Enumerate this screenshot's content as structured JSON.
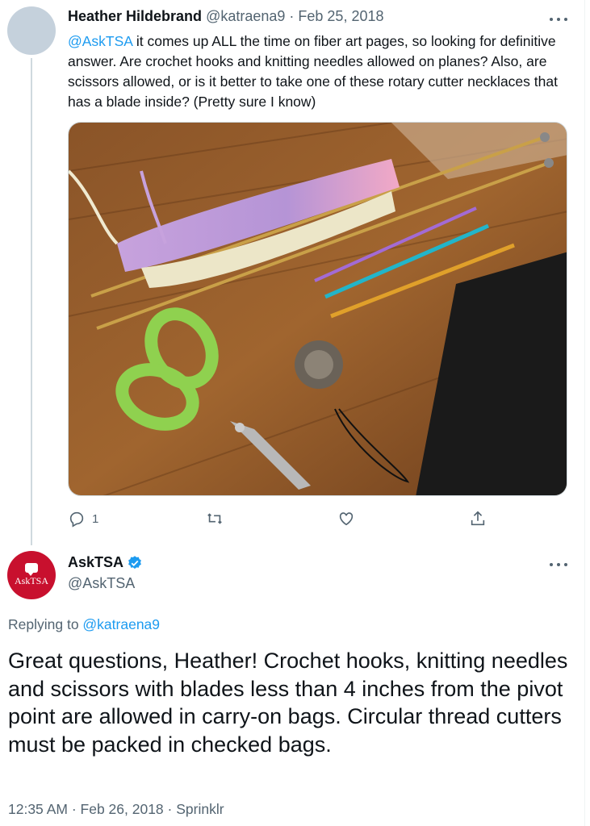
{
  "parent_tweet": {
    "author_name": "Heather Hildebrand",
    "author_handle": "@katraena9",
    "separator": " · ",
    "date": "Feb 25, 2018",
    "text_mention": "@AskTSA",
    "text_body": " it comes up ALL the time on fiber art pages, so looking for definitive answer. Are crochet hooks and knitting needles allowed on planes? Also, are scissors allowed, or is it better to take one of these rotary cutter necklaces that has a blade inside? (Pretty sure I know)",
    "photo_icon": "photo-knitting-supplies",
    "actions": {
      "reply_icon": "reply-icon",
      "reply_count": "1",
      "retweet_icon": "retweet-icon",
      "like_icon": "heart-icon",
      "share_icon": "share-icon"
    }
  },
  "reply_tweet": {
    "author_name": "AskTSA",
    "author_handle": "@AskTSA",
    "avatar_label": "AskTSA",
    "replying_prefix": "Replying to ",
    "replying_handle": "@katraena9",
    "text": "Great questions, Heather! Crochet hooks, knitting needles and scissors with blades less than 4 inches from the pivot point are allowed in carry-on bags. Circular thread cutters must be packed in checked bags.",
    "time": "12:35 AM",
    "separator": " · ",
    "date": "Feb 26, 2018",
    "source_separator": " · ",
    "source": "Sprinklr"
  },
  "colors": {
    "link": "#1d9bf0",
    "secondary_text": "#536471",
    "tsa_red": "#c8102e",
    "verified": "#1d9bf0"
  }
}
